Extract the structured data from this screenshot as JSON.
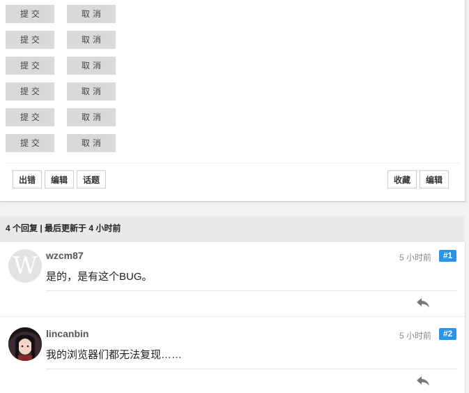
{
  "form_buttons": [
    {
      "submit": "提交",
      "cancel": "取消"
    },
    {
      "submit": "提交",
      "cancel": "取消"
    },
    {
      "submit": "提交",
      "cancel": "取消"
    },
    {
      "submit": "提交",
      "cancel": "取消"
    },
    {
      "submit": "提交",
      "cancel": "取消"
    },
    {
      "submit": "提交",
      "cancel": "取消"
    }
  ],
  "post_actions": {
    "left": [
      "出错",
      "编辑",
      "话题"
    ],
    "right": [
      "收藏",
      "编辑"
    ]
  },
  "replies_header": "4 个回复 | 最后更新于 4 小时前",
  "replies": [
    {
      "author": "wzcm87",
      "avatar_letter": "W",
      "time": "5 小时前",
      "floor": "#1",
      "content": "是的，是有这个BUG。"
    },
    {
      "author": "lincanbin",
      "time": "5 小时前",
      "floor": "#2",
      "content": "我的浏览器们都无法复现……"
    }
  ],
  "colors": {
    "floor_badge": "#2b93ea",
    "gray_button": "#d9d9d9"
  },
  "icons": {
    "reply": "reply-arrow-icon"
  }
}
